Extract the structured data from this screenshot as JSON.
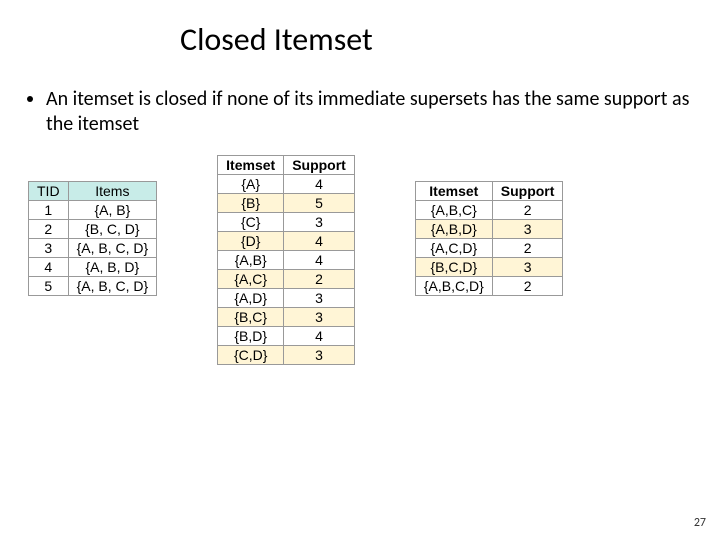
{
  "title": "Closed Itemset",
  "bullet": "An itemset is closed if none of its immediate supersets has the same support as the itemset",
  "table_tid": {
    "headers": [
      "TID",
      "Items"
    ],
    "rows": [
      [
        "1",
        "{A, B}"
      ],
      [
        "2",
        "{B, C, D}"
      ],
      [
        "3",
        "{A, B, C, D}"
      ],
      [
        "4",
        "{A, B, D}"
      ],
      [
        "5",
        "{A, B, C, D}"
      ]
    ]
  },
  "table_mid": {
    "headers": [
      "Itemset",
      "Support"
    ],
    "rows": [
      [
        "{A}",
        "4"
      ],
      [
        "{B}",
        "5"
      ],
      [
        "{C}",
        "3"
      ],
      [
        "{D}",
        "4"
      ],
      [
        "{A,B}",
        "4"
      ],
      [
        "{A,C}",
        "2"
      ],
      [
        "{A,D}",
        "3"
      ],
      [
        "{B,C}",
        "3"
      ],
      [
        "{B,D}",
        "4"
      ],
      [
        "{C,D}",
        "3"
      ]
    ]
  },
  "table_right": {
    "headers": [
      "Itemset",
      "Support"
    ],
    "rows": [
      [
        "{A,B,C}",
        "2"
      ],
      [
        "{A,B,D}",
        "3"
      ],
      [
        "{A,C,D}",
        "2"
      ],
      [
        "{B,C,D}",
        "3"
      ],
      [
        "{A,B,C,D}",
        "2"
      ]
    ]
  },
  "page_number": "27"
}
